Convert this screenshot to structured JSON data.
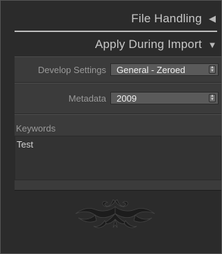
{
  "file_handling": {
    "title": "File Handling",
    "arrow": "◀"
  },
  "apply_during_import": {
    "title": "Apply During Import",
    "arrow": "▼",
    "develop_settings": {
      "label": "Develop Settings",
      "value": "General - Zeroed"
    },
    "metadata": {
      "label": "Metadata",
      "value": "2009"
    },
    "keywords": {
      "label": "Keywords",
      "value": "Test"
    }
  },
  "colors": {
    "panel_bg": "#2b2b2b",
    "section_bg": "#3b3b3b",
    "select_bg": "#5a5a5a",
    "text": "#bfbfbf",
    "label_text": "#9a9a9a"
  },
  "icons": {
    "collapse_arrow": "triangle-left-icon",
    "expand_arrow": "triangle-down-icon",
    "stepper": "up-down-stepper-icon",
    "ornament": "tribal-ornament-icon"
  }
}
